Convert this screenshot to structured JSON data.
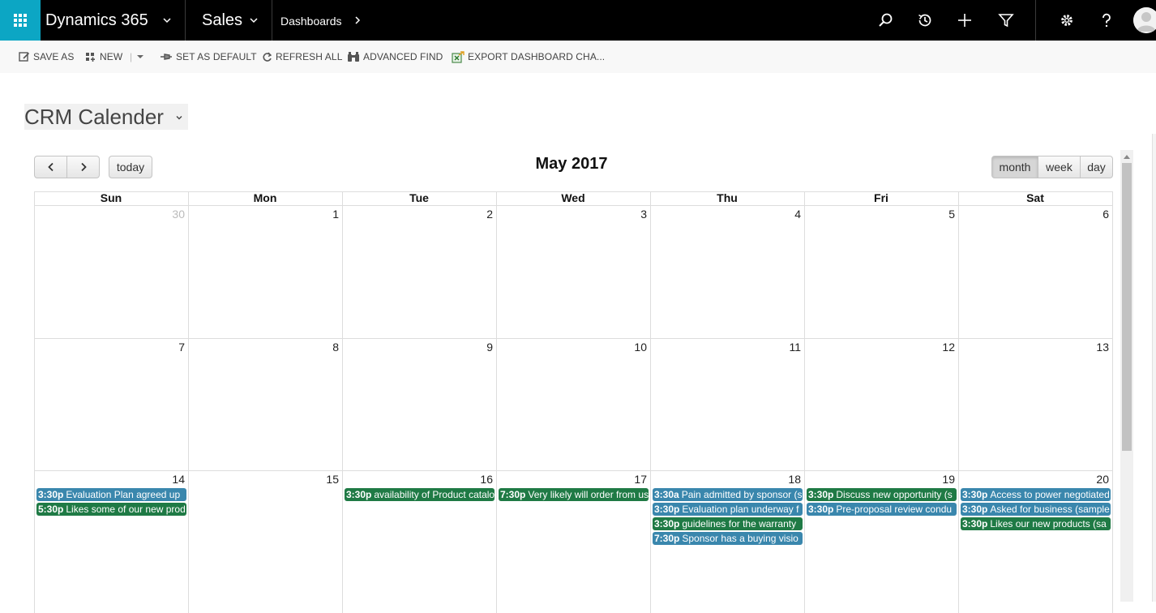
{
  "nav": {
    "brand": "Dynamics 365",
    "app": "Sales",
    "breadcrumb": "Dashboards"
  },
  "commands": {
    "save_as": "SAVE AS",
    "new": "NEW",
    "set_default": "SET AS DEFAULT",
    "refresh_all": "REFRESH ALL",
    "advanced_find": "ADVANCED FIND",
    "export": "EXPORT DASHBOARD CHA..."
  },
  "dashboard": {
    "title": "CRM Calender"
  },
  "calendar": {
    "title": "May 2017",
    "today_label": "today",
    "views": {
      "month": "month",
      "week": "week",
      "day": "day"
    },
    "days_of_week": [
      "Sun",
      "Mon",
      "Tue",
      "Wed",
      "Thu",
      "Fri",
      "Sat"
    ],
    "weeks": [
      [
        "30",
        "1",
        "2",
        "3",
        "4",
        "5",
        "6"
      ],
      [
        "7",
        "8",
        "9",
        "10",
        "11",
        "12",
        "13"
      ],
      [
        "14",
        "15",
        "16",
        "17",
        "18",
        "19",
        "20"
      ]
    ],
    "events": {
      "sun14": [
        {
          "time": "3:30p",
          "title": "Evaluation Plan agreed up"
        },
        {
          "time": "5:30p",
          "title": "Likes some of our new prod"
        }
      ],
      "tue16": [
        {
          "time": "3:30p",
          "title": "availability of Product catalo"
        }
      ],
      "wed17": [
        {
          "time": "7:30p",
          "title": "Very likely will order from us"
        }
      ],
      "thu18": [
        {
          "time": "3:30a",
          "title": "Pain admitted by sponsor (s"
        },
        {
          "time": "3:30p",
          "title": "Evaluation plan underway f"
        },
        {
          "time": "3:30p",
          "title": "guidelines for the warranty"
        },
        {
          "time": "7:30p",
          "title": "Sponsor has a buying visio"
        }
      ],
      "fri19": [
        {
          "time": "3:30p",
          "title": "Discuss new opportunity (s"
        },
        {
          "time": "3:30p",
          "title": "Pre-proposal review condu"
        }
      ],
      "sat20": [
        {
          "time": "3:30p",
          "title": "Access to power negotiated"
        },
        {
          "time": "3:30p",
          "title": "Asked for business (sample"
        },
        {
          "time": "3:30p",
          "title": "Likes our new products (sa"
        }
      ]
    }
  },
  "colors": {
    "waffle": "#0ca6c4",
    "event_blue": "#3a87ad",
    "event_green": "#1f7a45"
  }
}
